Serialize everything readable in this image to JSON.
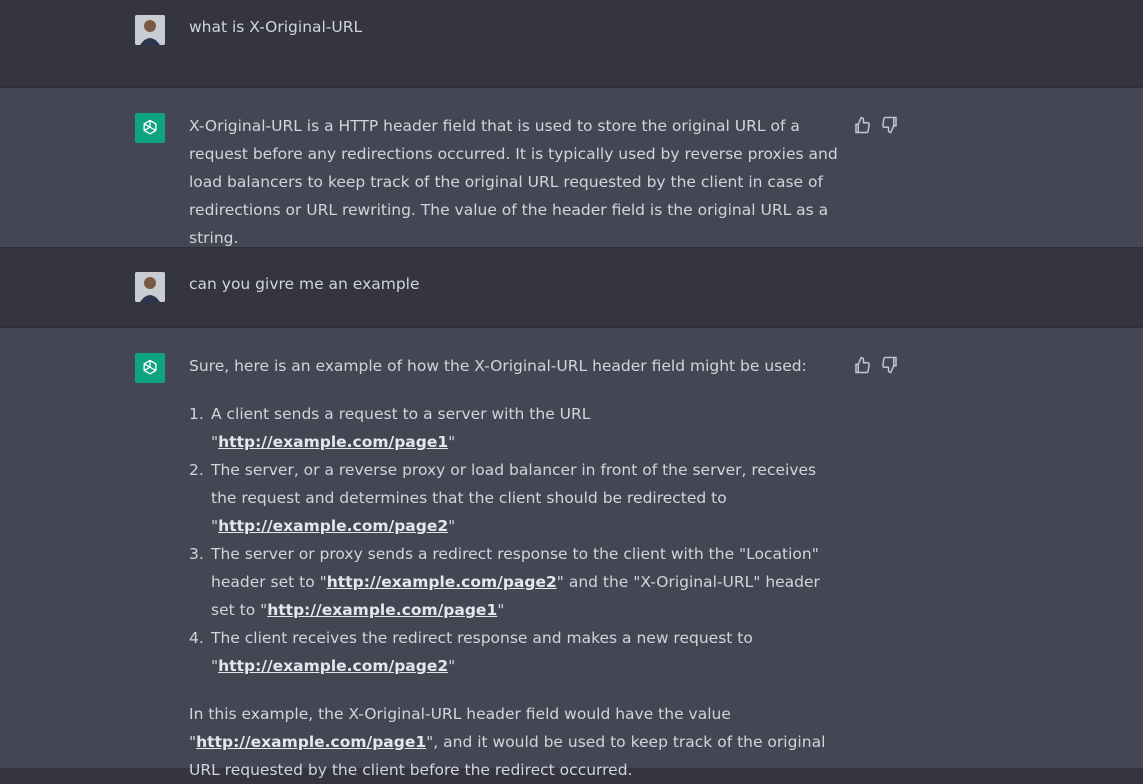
{
  "messages": [
    {
      "role": "user",
      "text": "what is X-Original-URL"
    },
    {
      "role": "assistant",
      "text": "X-Original-URL is a HTTP header field that is used to store the original URL of a request before any redirections occurred. It is typically used by reverse proxies and load balancers to keep track of the original URL requested by the client in case of redirections or URL rewriting. The value of the header field is the original URL as a string."
    },
    {
      "role": "user",
      "text": "can you givre me an example"
    },
    {
      "role": "assistant",
      "intro": "Sure, here is an example of how the X-Original-URL header field might be used:",
      "steps": [
        {
          "num": "1.",
          "a": "A client sends a request to a server with the URL \"",
          "link": "http://example.com/page1",
          "b": "\""
        },
        {
          "num": "2.",
          "a": "The server, or a reverse proxy or load balancer in front of the server, receives the request and determines that the client should be redirected to \"",
          "link": "http://example.com/page2",
          "b": "\""
        },
        {
          "num": "3.",
          "a": "The server or proxy sends a redirect response to the client with the \"Location\" header set to \"",
          "link": "http://example.com/page2",
          "b": "\" and the \"X-Original-URL\" header set to \"",
          "link2": "http://example.com/page1",
          "c": "\""
        },
        {
          "num": "4.",
          "a": "The client receives the redirect response and makes a new request to \"",
          "link": "http://example.com/page2",
          "b": "\""
        }
      ],
      "outro_a": "In this example, the X-Original-URL header field would have the value \"",
      "outro_link": "http://example.com/page1",
      "outro_b": "\", and it would be used to keep track of the original URL requested by the client before the redirect occurred."
    }
  ],
  "colors": {
    "user_bg": "#343541",
    "bot_bg": "#444654",
    "bot_avatar": "#10a37f",
    "text": "#d1d5db"
  },
  "icons": [
    "user-avatar",
    "openai-logo-icon",
    "thumbs-up-icon",
    "thumbs-down-icon"
  ]
}
